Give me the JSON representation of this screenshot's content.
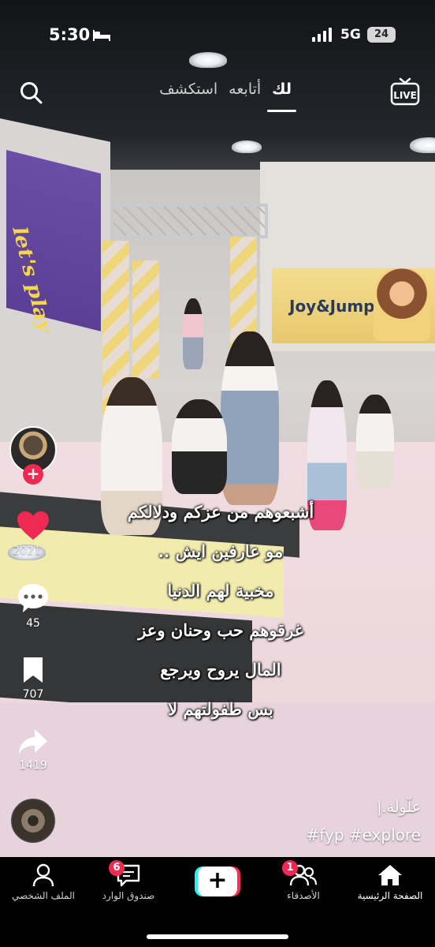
{
  "status_bar": {
    "time": "5:30",
    "network": "5G",
    "battery": "24"
  },
  "top_nav": {
    "tabs": [
      {
        "label": "لك",
        "active": true
      },
      {
        "label": "أتابعه",
        "active": false
      },
      {
        "label": "استكشف",
        "active": false
      }
    ],
    "live_label": "LIVE"
  },
  "video_scene": {
    "banner_left_text": "let's play",
    "banner_right_text": "Joy&Jump"
  },
  "actions": {
    "likes": "2021",
    "comments": "45",
    "saves": "707",
    "shares": "1419",
    "like_color": "#ee2a52"
  },
  "caption_overlay": [
    "أشبعوهم من عزكم ودلالكم",
    "مو عارفين ايش ..",
    "مخبية لهم الدنيا",
    "غرقوهم حب وحنان وعز",
    "المال يروح ويرجع",
    "بس طفولتهم لا"
  ],
  "post": {
    "author": "علّولة.|",
    "hashtags": "#fyp #explore"
  },
  "tab_bar": {
    "home": "الصفحة الرئيسية",
    "friends": "الأصدقاء",
    "friends_badge": "1",
    "inbox": "صندوق الوارد",
    "inbox_badge": "6",
    "profile": "الملف الشخصي"
  },
  "colors": {
    "accent_red": "#fe2c55",
    "accent_cyan": "#27f1e9"
  }
}
